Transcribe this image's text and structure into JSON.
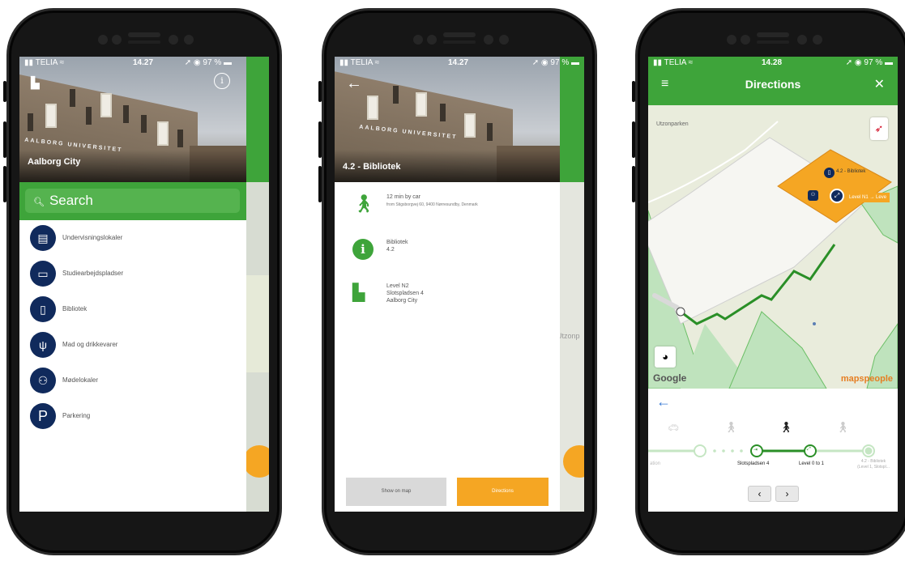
{
  "phone1": {
    "status": {
      "carrier": "▮▮ TELIA ≈",
      "time": "14.27",
      "battery": "➚ ◉ 97 % ▬"
    },
    "header_title": "Aalborg City",
    "building_sign": "AALBORG UNIVERSITET",
    "search_label": "Search",
    "categories": [
      {
        "label": "Undervisningslokaler",
        "icon": "lectern-icon",
        "glyph": "▤"
      },
      {
        "label": "Studiearbejdspladser",
        "icon": "computer-icon",
        "glyph": "▭"
      },
      {
        "label": "Bibliotek",
        "icon": "book-icon",
        "glyph": "▯"
      },
      {
        "label": "Mad og drikkevarer",
        "icon": "cutlery-icon",
        "glyph": "ψ"
      },
      {
        "label": "Mødelokaler",
        "icon": "meeting-icon",
        "glyph": "⚇"
      },
      {
        "label": "Parkering",
        "icon": "parking-icon",
        "glyph": "P"
      }
    ]
  },
  "phone2": {
    "status": {
      "carrier": "▮▮ TELIA ≈",
      "time": "14.27",
      "battery": "➚ ◉ 97 % ▬"
    },
    "title": "4.2 - Bibliotek",
    "building_sign": "AALBORG UNIVERSITET",
    "rows": [
      {
        "icon": "walking-icon",
        "line1": "12 min by car",
        "line2": "from Stigsborgvej 60, 9400 Nørresundby, Denmark"
      },
      {
        "icon": "info-icon",
        "line1": "Bibliotek",
        "line2": "4.2"
      },
      {
        "icon": "building-icon",
        "line1": "Level N2",
        "line2": "Slotspladsen 4",
        "line3": "Aalborg City"
      }
    ],
    "show_on_map_label": "Show on map",
    "directions_label": "Directions",
    "background_peek": "Utzonp"
  },
  "phone3": {
    "status": {
      "carrier": "▮▮ TELIA ≈",
      "time": "14.28",
      "battery": "➚ ◉ 97 % ▬"
    },
    "title": "Directions",
    "map_labels": {
      "park": "Utzonparken",
      "poi": "4.2 - Bibliotek",
      "level_tag": "Level N1 → Leve"
    },
    "google_label": "Google",
    "mapspeople_label": "mapspeople",
    "step_labels": {
      "left": "ation",
      "s1": "Slotspladsen 4",
      "s2": "Level 0 to 1",
      "s3_1": "4.2 - Bibliotek",
      "s3_2": "(Level 1, Slotspl..."
    },
    "colors": {
      "accent": "#3ea43a",
      "orange": "#f5a623",
      "navy": "#102a5c"
    }
  }
}
